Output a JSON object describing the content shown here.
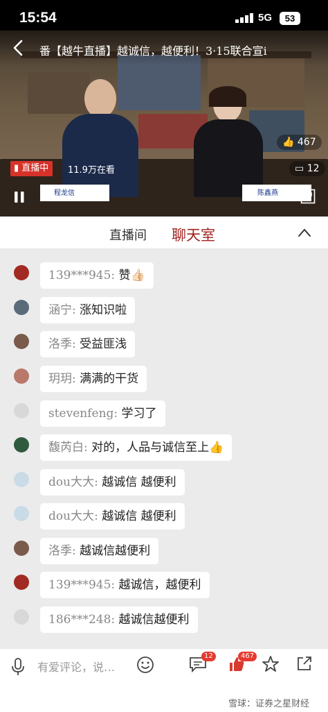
{
  "status_bar": {
    "time": "15:54",
    "network": "5G",
    "battery": "53"
  },
  "video": {
    "title": "番【越牛直播】越诚信，越便利！3·15联合宣i",
    "live_label": "直播中",
    "viewers": "11.9万在看",
    "like_count": "467",
    "comment_count": "12",
    "host_left_name": "程龙信",
    "host_right_name": "陈鑫燕"
  },
  "tabs": {
    "live_room": "直播间",
    "chat_room": "聊天室"
  },
  "chat": [
    {
      "name": "139***945:",
      "text": "赞👍🏻",
      "avatar": "#a12a22"
    },
    {
      "name": "涵宁:",
      "text": "涨知识啦",
      "avatar": "#5a6b7a"
    },
    {
      "name": "洛季:",
      "text": "受益匪浅",
      "avatar": "#7a5a4a"
    },
    {
      "name": "玥玥:",
      "text": "满满的干货",
      "avatar": "#b8786a"
    },
    {
      "name": "stevenfeng:",
      "text": "学习了",
      "avatar": "#d8d8d8"
    },
    {
      "name": "馥芮白:",
      "text": "对的，人品与诚信至上👍",
      "avatar": "#2f5a3e"
    },
    {
      "name": "dou大大:",
      "text": "越诚信  越便利",
      "avatar": "#c9dbe6"
    },
    {
      "name": "dou大大:",
      "text": "越诚信  越便利",
      "avatar": "#c9dbe6"
    },
    {
      "name": "洛季:",
      "text": "越诚信越便利",
      "avatar": "#7a5a4a"
    },
    {
      "name": "139***945:",
      "text": "越诚信，越便利",
      "avatar": "#a12a22"
    },
    {
      "name": "186***248:",
      "text": "越诚信越便利",
      "avatar": "#d8d8d8"
    }
  ],
  "bottom_bar": {
    "placeholder": "有爱评论，说…",
    "comment_badge": "12",
    "like_badge": "467",
    "watermark": "雪球：证券之星财经"
  },
  "colors": {
    "accent": "#a0221f",
    "live_red": "#d6322a",
    "badge": "#e63a2e"
  }
}
